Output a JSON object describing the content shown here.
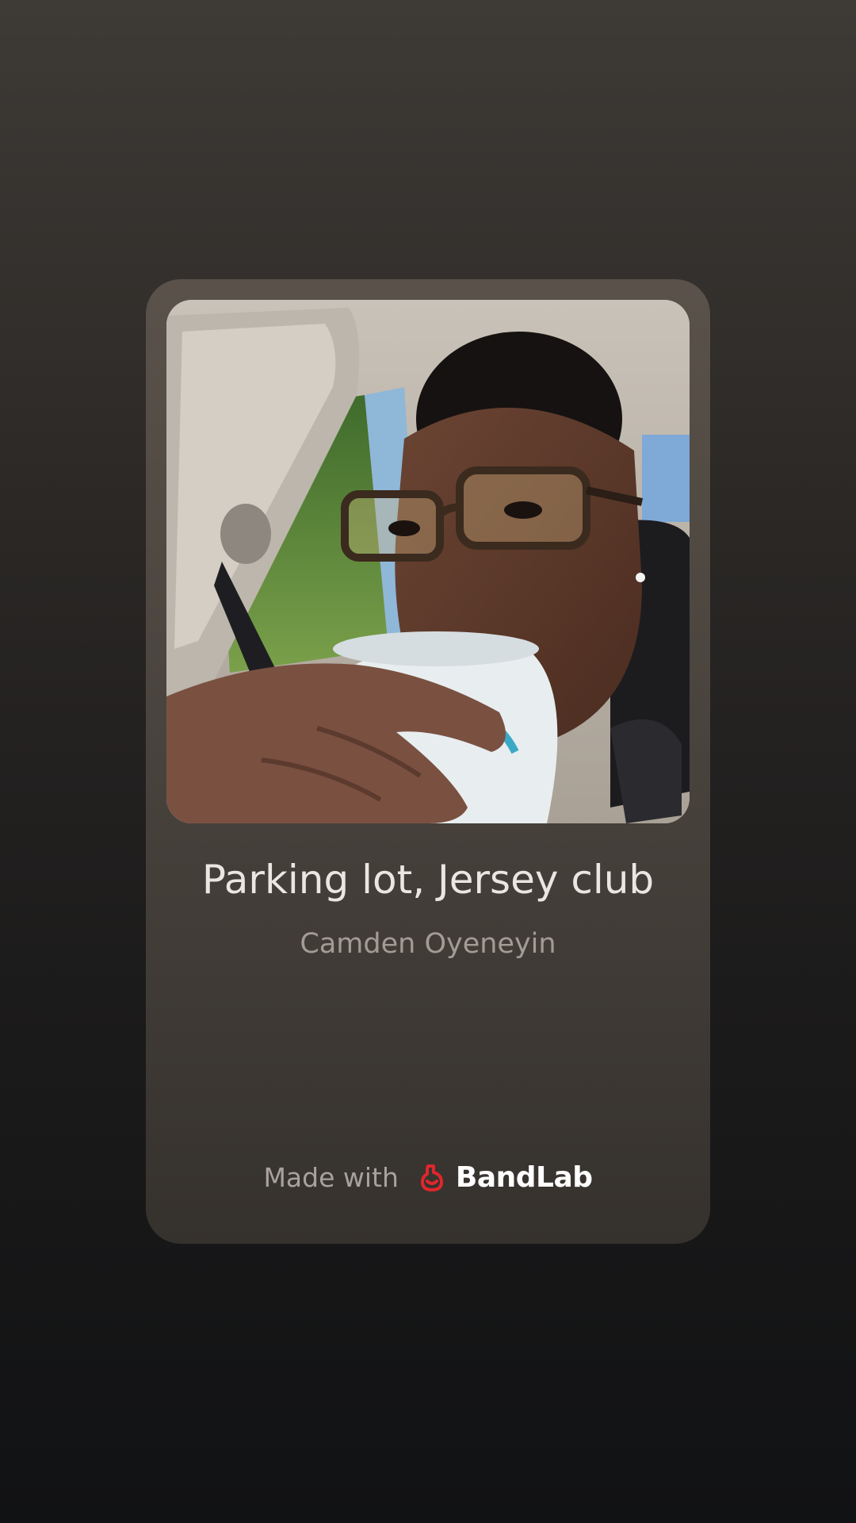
{
  "track": {
    "title": "Parking lot, Jersey club",
    "artist": "Camden Oyeneyin"
  },
  "footer": {
    "made_with_label": "Made with",
    "brand_name": "BandLab",
    "brand_icon": "bandlab-logo-icon",
    "brand_color": "#e0262d"
  },
  "colors": {
    "card_top": "#5a524a",
    "card_bottom": "#35312d",
    "background_top": "#3e3a36",
    "background_bottom": "#111214"
  }
}
